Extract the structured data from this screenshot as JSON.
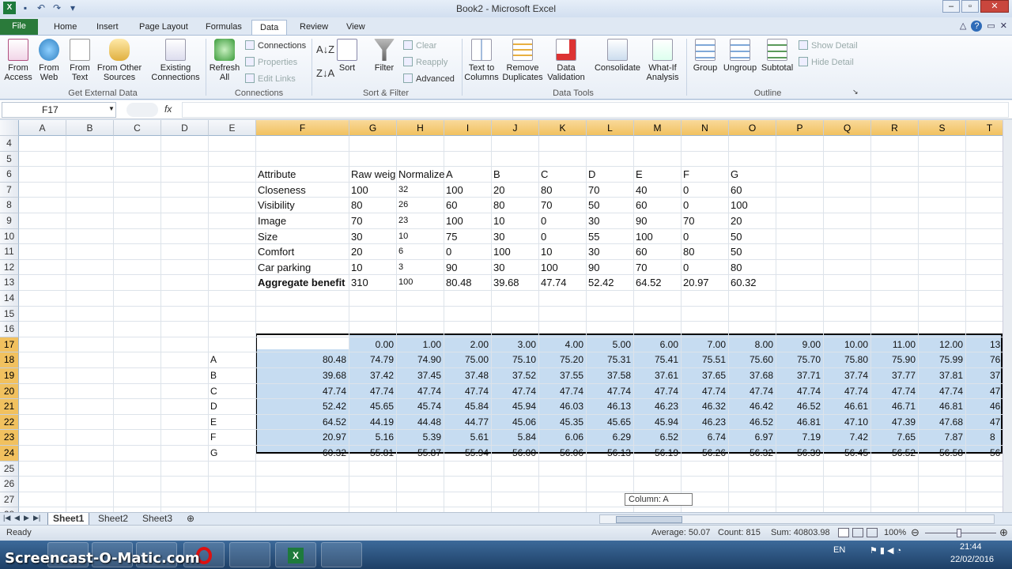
{
  "window": {
    "title": "Book2 - Microsoft Excel"
  },
  "tabs": [
    "File",
    "Home",
    "Insert",
    "Page Layout",
    "Formulas",
    "Data",
    "Review",
    "View"
  ],
  "active_tab": "Data",
  "ribbon": {
    "get_external": {
      "from_access": "From Access",
      "from_web": "From Web",
      "from_text": "From Text",
      "from_other": "From Other Sources",
      "existing": "Existing Connections",
      "label": "Get External Data"
    },
    "connections": {
      "refresh": "Refresh All",
      "connections": "Connections",
      "properties": "Properties",
      "edit_links": "Edit Links",
      "label": "Connections"
    },
    "sort_filter": {
      "sort": "Sort",
      "filter": "Filter",
      "clear": "Clear",
      "reapply": "Reapply",
      "advanced": "Advanced",
      "label": "Sort & Filter"
    },
    "data_tools": {
      "text_to_columns": "Text to Columns",
      "remove_dup": "Remove Duplicates",
      "validation": "Data Validation",
      "consolidate": "Consolidate",
      "whatif": "What-If Analysis",
      "label": "Data Tools"
    },
    "outline": {
      "group": "Group",
      "ungroup": "Ungroup",
      "subtotal": "Subtotal",
      "show_detail": "Show Detail",
      "hide_detail": "Hide Detail",
      "label": "Outline"
    }
  },
  "formula_bar": {
    "name_box": "F17",
    "fx": "fx",
    "value": ""
  },
  "columns": [
    "A",
    "B",
    "C",
    "D",
    "E",
    "F",
    "G",
    "H",
    "I",
    "J",
    "K",
    "L",
    "M",
    "N",
    "O",
    "P",
    "Q",
    "R",
    "S",
    "T"
  ],
  "rows": [
    "4",
    "5",
    "6",
    "7",
    "8",
    "9",
    "10",
    "11",
    "12",
    "13",
    "14",
    "15",
    "16",
    "17",
    "18",
    "19",
    "20",
    "21",
    "22",
    "23",
    "24",
    "25",
    "26",
    "27",
    "28"
  ],
  "table1": {
    "header": [
      "Attribute",
      "Raw weig",
      "Normalize",
      "A",
      "B",
      "C",
      "D",
      "E",
      "F",
      "G"
    ],
    "rows": [
      [
        "Closeness",
        "100",
        "32",
        "100",
        "20",
        "80",
        "70",
        "40",
        "0",
        "60"
      ],
      [
        "Visibility",
        "80",
        "26",
        "60",
        "80",
        "70",
        "50",
        "60",
        "0",
        "100"
      ],
      [
        "Image",
        "70",
        "23",
        "100",
        "10",
        "0",
        "30",
        "90",
        "70",
        "20"
      ],
      [
        "Size",
        "30",
        "10",
        "75",
        "30",
        "0",
        "55",
        "100",
        "0",
        "50"
      ],
      [
        "Comfort",
        "20",
        "6",
        "0",
        "100",
        "10",
        "30",
        "60",
        "80",
        "50"
      ],
      [
        "Car parking",
        "10",
        "3",
        "90",
        "30",
        "100",
        "90",
        "70",
        "0",
        "80"
      ],
      [
        "Aggregate benefit",
        "310",
        "100",
        "80.48",
        "39.68",
        "47.74",
        "52.42",
        "64.52",
        "20.97",
        "60.32"
      ]
    ]
  },
  "table2": {
    "header": [
      "0.00",
      "1.00",
      "2.00",
      "3.00",
      "4.00",
      "5.00",
      "6.00",
      "7.00",
      "8.00",
      "9.00",
      "10.00",
      "11.00",
      "12.00",
      "13"
    ],
    "labels": [
      "A",
      "B",
      "C",
      "D",
      "E",
      "F",
      "G"
    ],
    "rows": [
      [
        "80.48",
        "74.79",
        "74.90",
        "75.00",
        "75.10",
        "75.20",
        "75.31",
        "75.41",
        "75.51",
        "75.60",
        "75.70",
        "75.80",
        "75.90",
        "75.99",
        "76"
      ],
      [
        "39.68",
        "37.42",
        "37.45",
        "37.48",
        "37.52",
        "37.55",
        "37.58",
        "37.61",
        "37.65",
        "37.68",
        "37.71",
        "37.74",
        "37.77",
        "37.81",
        "37"
      ],
      [
        "47.74",
        "47.74",
        "47.74",
        "47.74",
        "47.74",
        "47.74",
        "47.74",
        "47.74",
        "47.74",
        "47.74",
        "47.74",
        "47.74",
        "47.74",
        "47.74",
        "47"
      ],
      [
        "52.42",
        "45.65",
        "45.74",
        "45.84",
        "45.94",
        "46.03",
        "46.13",
        "46.23",
        "46.32",
        "46.42",
        "46.52",
        "46.61",
        "46.71",
        "46.81",
        "46"
      ],
      [
        "64.52",
        "44.19",
        "44.48",
        "44.77",
        "45.06",
        "45.35",
        "45.65",
        "45.94",
        "46.23",
        "46.52",
        "46.81",
        "47.10",
        "47.39",
        "47.68",
        "47"
      ],
      [
        "20.97",
        "5.16",
        "5.39",
        "5.61",
        "5.84",
        "6.06",
        "6.29",
        "6.52",
        "6.74",
        "6.97",
        "7.19",
        "7.42",
        "7.65",
        "7.87",
        "8"
      ],
      [
        "60.32",
        "55.81",
        "55.87",
        "55.94",
        "56.00",
        "56.06",
        "56.13",
        "56.19",
        "56.26",
        "56.32",
        "56.39",
        "56.45",
        "56.52",
        "56.58",
        "56"
      ]
    ]
  },
  "sheets": [
    "Sheet1",
    "Sheet2",
    "Sheet3"
  ],
  "active_sheet": "Sheet1",
  "tooltip": "Column: A",
  "status": {
    "ready": "Ready",
    "average": "Average: 50.07",
    "count": "Count: 815",
    "sum": "Sum: 40803.98",
    "zoom": "100%"
  },
  "taskbar": {
    "watermark": "Screencast-O-Matic.com",
    "lang": "EN",
    "time": "21:44",
    "date": "22/02/2016"
  }
}
